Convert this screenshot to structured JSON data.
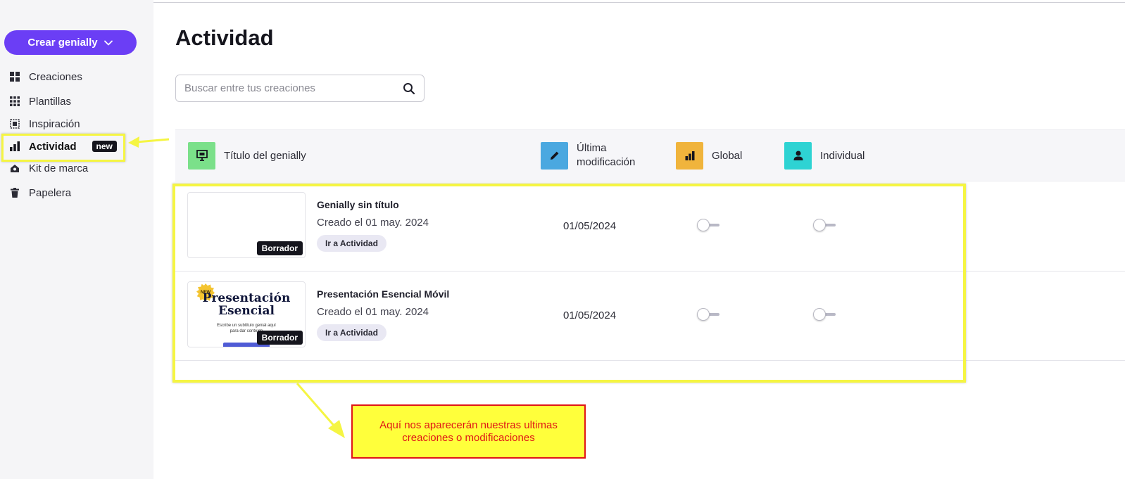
{
  "sidebar": {
    "create_button": "Crear genially",
    "items": [
      {
        "label": "Creaciones",
        "icon": "grid-icon"
      },
      {
        "label": "Plantillas",
        "icon": "dots-grid-icon"
      },
      {
        "label": "Inspiración",
        "icon": "inspiration-icon"
      },
      {
        "label": "Actividad",
        "icon": "bar-chart-icon",
        "badge": "new",
        "active": true
      },
      {
        "label": "Kit de marca",
        "icon": "brand-kit-icon"
      },
      {
        "label": "Papelera",
        "icon": "trash-icon"
      }
    ]
  },
  "main": {
    "title": "Actividad",
    "search": {
      "placeholder": "Buscar entre tus creaciones",
      "value": ""
    },
    "columns": [
      {
        "label": "Título del genially",
        "icon": "presentation-icon",
        "color": "#7be08a"
      },
      {
        "label": "Última modificación",
        "icon": "pencil-icon",
        "color": "#4aa8e0"
      },
      {
        "label": "Global",
        "icon": "bar-chart-icon",
        "color": "#f0b43c"
      },
      {
        "label": "Individual",
        "icon": "person-icon",
        "color": "#2ed3d3"
      }
    ],
    "rows": [
      {
        "title": "Genially sin título",
        "created": "Creado el 01 may. 2024",
        "status": "Borrador",
        "action": "Ir a Actividad",
        "modified": "01/05/2024",
        "global_on": false,
        "individual_on": false
      },
      {
        "title": "Presentación Esencial Móvil",
        "created": "Creado el 01 may. 2024",
        "status": "Borrador",
        "action": "Ir a Actividad",
        "modified": "01/05/2024",
        "global_on": false,
        "individual_on": false,
        "preview": {
          "sticker": "NEW",
          "title": "Presentación Esencial",
          "subtitle": "Escribe un subtítulo genial aquí para dar contexto"
        }
      }
    ]
  },
  "annotation": {
    "callout": "Aquí nos aparecerán nuestras ultimas creaciones o modificaciones",
    "highlight_color": "#f5f542",
    "callout_text_color": "#e01616"
  },
  "colors": {
    "accent": "#6b3ef5",
    "sidebar_bg": "#f5f5f7"
  }
}
